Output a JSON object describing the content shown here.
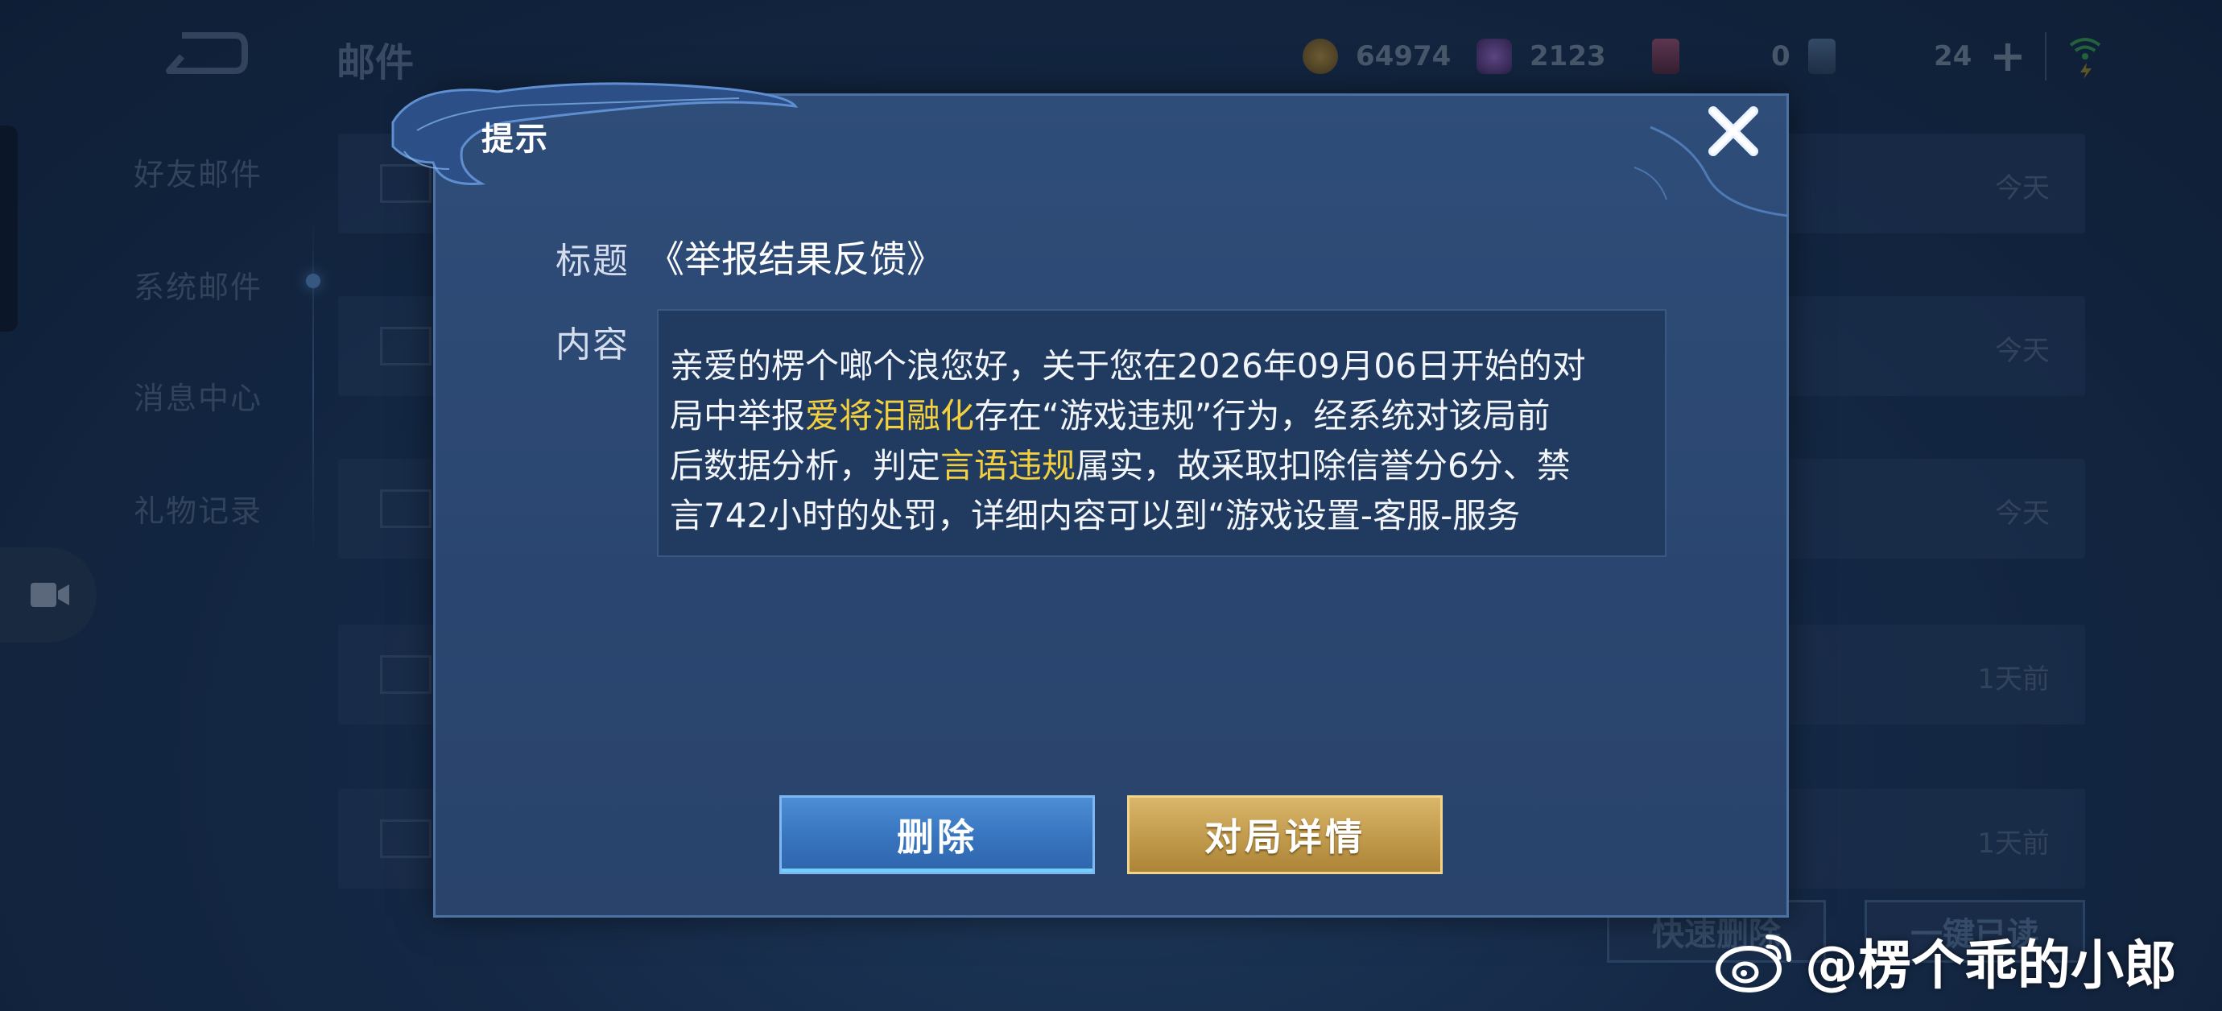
{
  "header": {
    "title": "邮件",
    "currencies": [
      {
        "icon": "gold-coin-icon",
        "value": "64974"
      },
      {
        "icon": "diamond-gem-icon",
        "value": "2123"
      },
      {
        "icon": "coupon-card-icon",
        "value": "0"
      },
      {
        "icon": "token-card-icon",
        "value": "24"
      }
    ]
  },
  "sidebar": {
    "items": [
      {
        "label": "好友邮件"
      },
      {
        "label": "系统邮件"
      },
      {
        "label": "消息中心"
      },
      {
        "label": "礼物记录"
      }
    ]
  },
  "mail_list": {
    "times": [
      "今天",
      "今天",
      "今天",
      "1天前",
      "1天前"
    ],
    "quick_delete_label": "快速删除",
    "read_all_label": "一键已读"
  },
  "dialog": {
    "title": "提示",
    "subject_label": "标题",
    "subject_value": "《举报结果反馈》",
    "content_label": "内容",
    "content": {
      "line1": "亲爱的楞个啷个浪您好，关于您在2026年09月06日开始的对",
      "line2_a": "局中举报",
      "line2_hl": "爱将泪融化",
      "line2_b": "存在“游戏违规”行为，经系统对该局前",
      "line3_a": "后数据分析，判定",
      "line3_hl": "言语违规",
      "line3_b": "属实，故采取扣除信誉分6分、禁",
      "line4": "言742小时的处罚，详细内容可以到“游戏设置-客服-服务"
    },
    "delete_label": "删除",
    "match_detail_label": "对局详情"
  },
  "watermark": {
    "text": "@楞个乖的小郎"
  },
  "colors": {
    "highlight": "#f1cf3f",
    "delete_button": "#3773be",
    "detail_button": "#c19a4c",
    "dialog_bg": "#2f4d79"
  }
}
